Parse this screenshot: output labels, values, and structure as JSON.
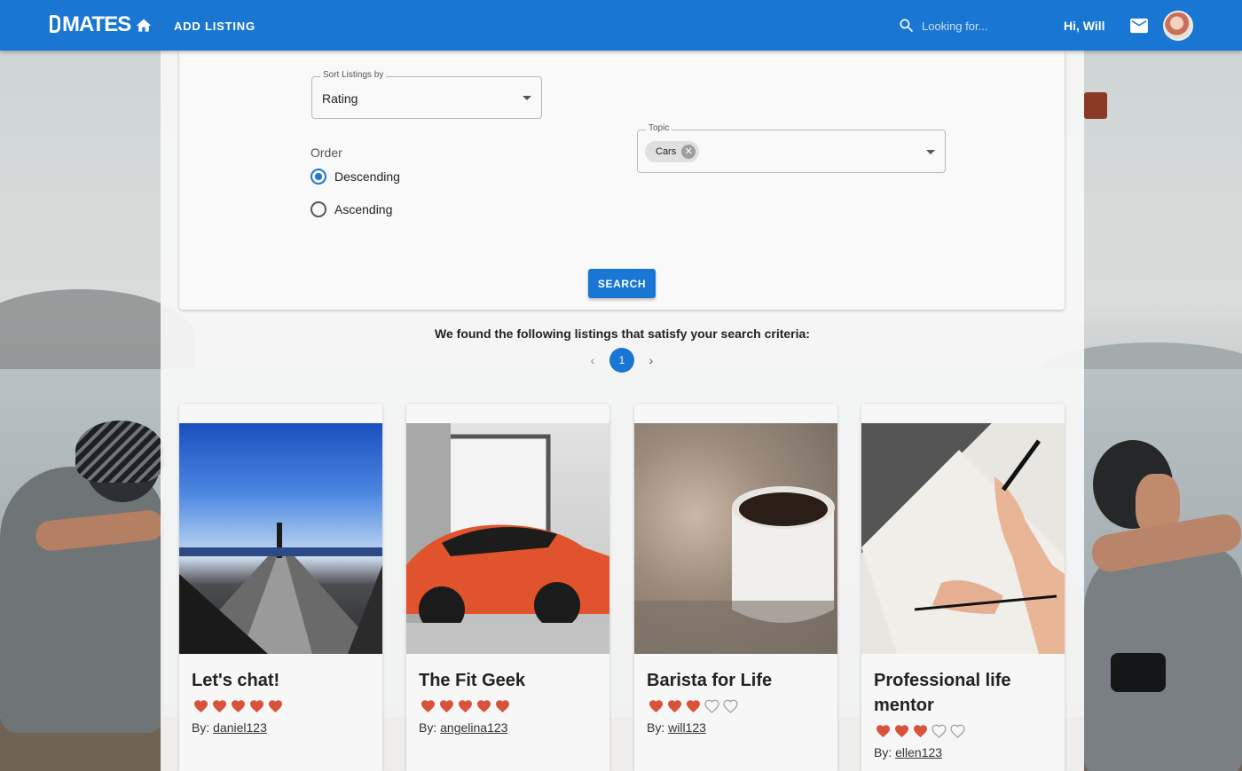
{
  "header": {
    "logo": "MATES",
    "add_listing": "ADD LISTING",
    "search_placeholder": "Looking for...",
    "greeting": "Hi, Will",
    "brand_color": "#1976d2"
  },
  "filters": {
    "sort_label": "Sort Listings by",
    "sort_value": "Rating",
    "order_label": "Order",
    "order_options": [
      {
        "label": "Descending",
        "selected": true
      },
      {
        "label": "Ascending",
        "selected": false
      }
    ],
    "topic_label": "Topic",
    "topic_chip": "Cars",
    "search_button": "SEARCH"
  },
  "results": {
    "message": "We found the following listings that satisfy your search criteria:",
    "current_page": "1",
    "prev_icon": "‹",
    "next_icon": "›"
  },
  "listings": [
    {
      "title": "Let's chat!",
      "rating": 5,
      "max_rating": 5,
      "by": "By:",
      "author": "daniel123"
    },
    {
      "title": "The Fit Geek",
      "rating": 5,
      "max_rating": 5,
      "by": "By:",
      "author": "angelina123"
    },
    {
      "title": "Barista for Life",
      "rating": 3,
      "max_rating": 5,
      "by": "By:",
      "author": "will123"
    },
    {
      "title": "Professional life mentor",
      "rating": 3,
      "max_rating": 5,
      "by": "By:",
      "author": "ellen123"
    }
  ],
  "icons": {
    "home": "home-icon",
    "search": "search-icon",
    "mail": "mail-icon",
    "heart_full": "heart-filled-icon",
    "heart_empty": "heart-outline-icon"
  },
  "colors": {
    "heart": "#d9533b",
    "heart_outline": "#9e9e9e"
  }
}
